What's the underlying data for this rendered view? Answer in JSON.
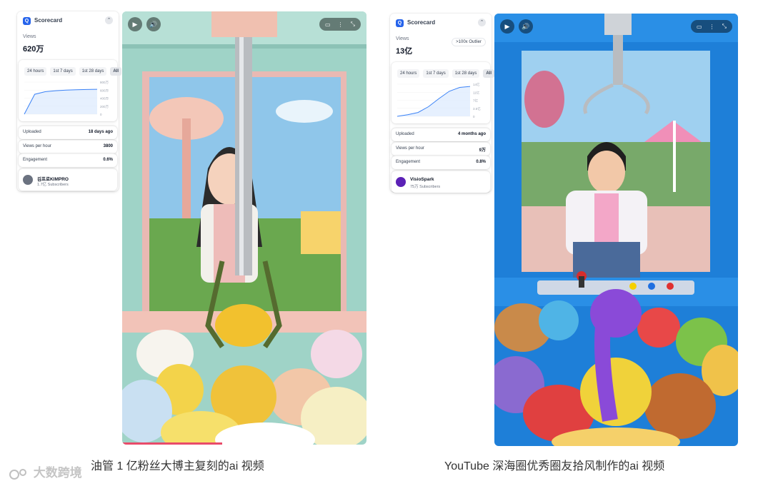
{
  "cards": [
    {
      "app_title": "Scorecard",
      "views_label": "Views",
      "views_value": "620万",
      "outlier": "",
      "tabs": [
        {
          "label": "24 hours",
          "active": false
        },
        {
          "label": "1st 7 days",
          "active": false
        },
        {
          "label": "1st 28 days",
          "active": false
        },
        {
          "label": "All",
          "active": true
        }
      ],
      "chart_data": {
        "type": "area",
        "y_ticks": [
          "800万",
          "600万",
          "400万",
          "200万",
          "0"
        ],
        "values": [
          0,
          0.62,
          0.7,
          0.73,
          0.75,
          0.76,
          0.77,
          0.775
        ]
      },
      "stats": [
        {
          "label": "Uploaded",
          "value": "18 days ago"
        },
        {
          "label": "Views per hour",
          "value": "3800"
        },
        {
          "label": "Engagement",
          "value": "0.6%"
        }
      ],
      "channel_name": "김프로KIMPRO",
      "channel_subs": "1.7亿 Subscribers",
      "avatar_color": "#6b7280"
    },
    {
      "app_title": "Scorecard",
      "views_label": "Views",
      "views_value": "13亿",
      "outlier": ">100x Outlier",
      "tabs": [
        {
          "label": "24 hours",
          "active": false
        },
        {
          "label": "1st 7 days",
          "active": false
        },
        {
          "label": "1st 28 days",
          "active": false
        },
        {
          "label": "All",
          "active": true
        }
      ],
      "chart_data": {
        "type": "area",
        "y_ticks": [
          "14亿",
          "11亿",
          "7亿",
          "3.5亿",
          "0"
        ],
        "values": [
          0,
          0.05,
          0.12,
          0.3,
          0.55,
          0.78,
          0.9,
          0.93
        ]
      },
      "stats": [
        {
          "label": "Uploaded",
          "value": "4 months ago"
        },
        {
          "label": "Views per hour",
          "value": "9万"
        },
        {
          "label": "Engagement",
          "value": "0.8%"
        }
      ],
      "channel_name": "VisioSpark",
      "channel_subs": "75万 Subscribers",
      "avatar_color": "#5b21b6"
    }
  ],
  "captions": {
    "left": "油管 1 亿粉丝大博主复刻的ai 视频",
    "right": "YouTube 深海圈优秀圈友拾风制作的ai 视频"
  },
  "watermark": "大数跨境",
  "icons": {
    "play": "play-icon",
    "volume": "volume-icon",
    "subtitles": "subtitles-icon",
    "more": "more-vert-icon",
    "fullscreen": "fullscreen-icon"
  },
  "colors": {
    "accent": "#2563eb",
    "chart_line": "#3b82f6",
    "chart_fill": "#dbeafe",
    "left_booth": "#9fd3c7",
    "right_booth": "#1e7fd8"
  }
}
